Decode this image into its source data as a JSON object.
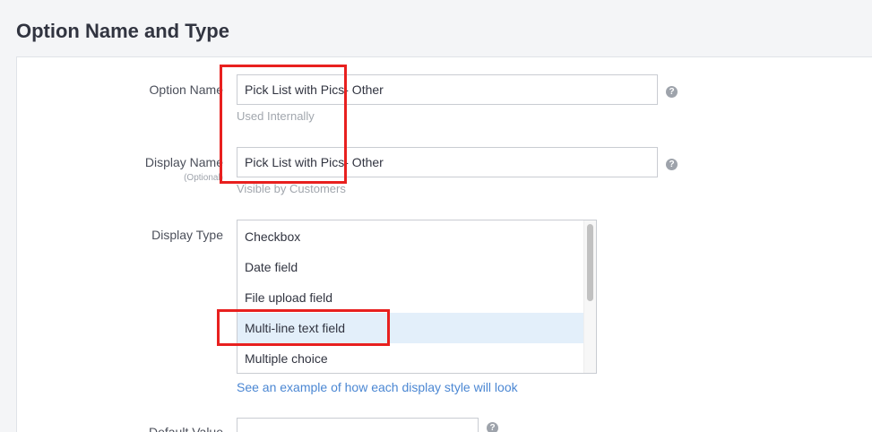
{
  "section": {
    "title": "Option Name and Type"
  },
  "option_name": {
    "label": "Option Name",
    "value": "Pick List with Pics- Other",
    "help": "Used Internally"
  },
  "display_name": {
    "label": "Display Name",
    "sublabel": "(Optional)",
    "value": "Pick List with Pics- Other",
    "help": "Visible by Customers"
  },
  "display_type": {
    "label": "Display Type",
    "options": [
      "Checkbox",
      "Date field",
      "File upload field",
      "Multi-line text field",
      "Multiple choice"
    ],
    "selected": "Multi-line text field",
    "example_link": "See an example of how each display style will look"
  },
  "default_value": {
    "label": "Default Value",
    "value": ""
  },
  "help_icon": "question-circle-icon",
  "colors": {
    "accent_link": "#4b87d3",
    "selected_bg": "#e3effa",
    "annotation": "#e8201f"
  }
}
